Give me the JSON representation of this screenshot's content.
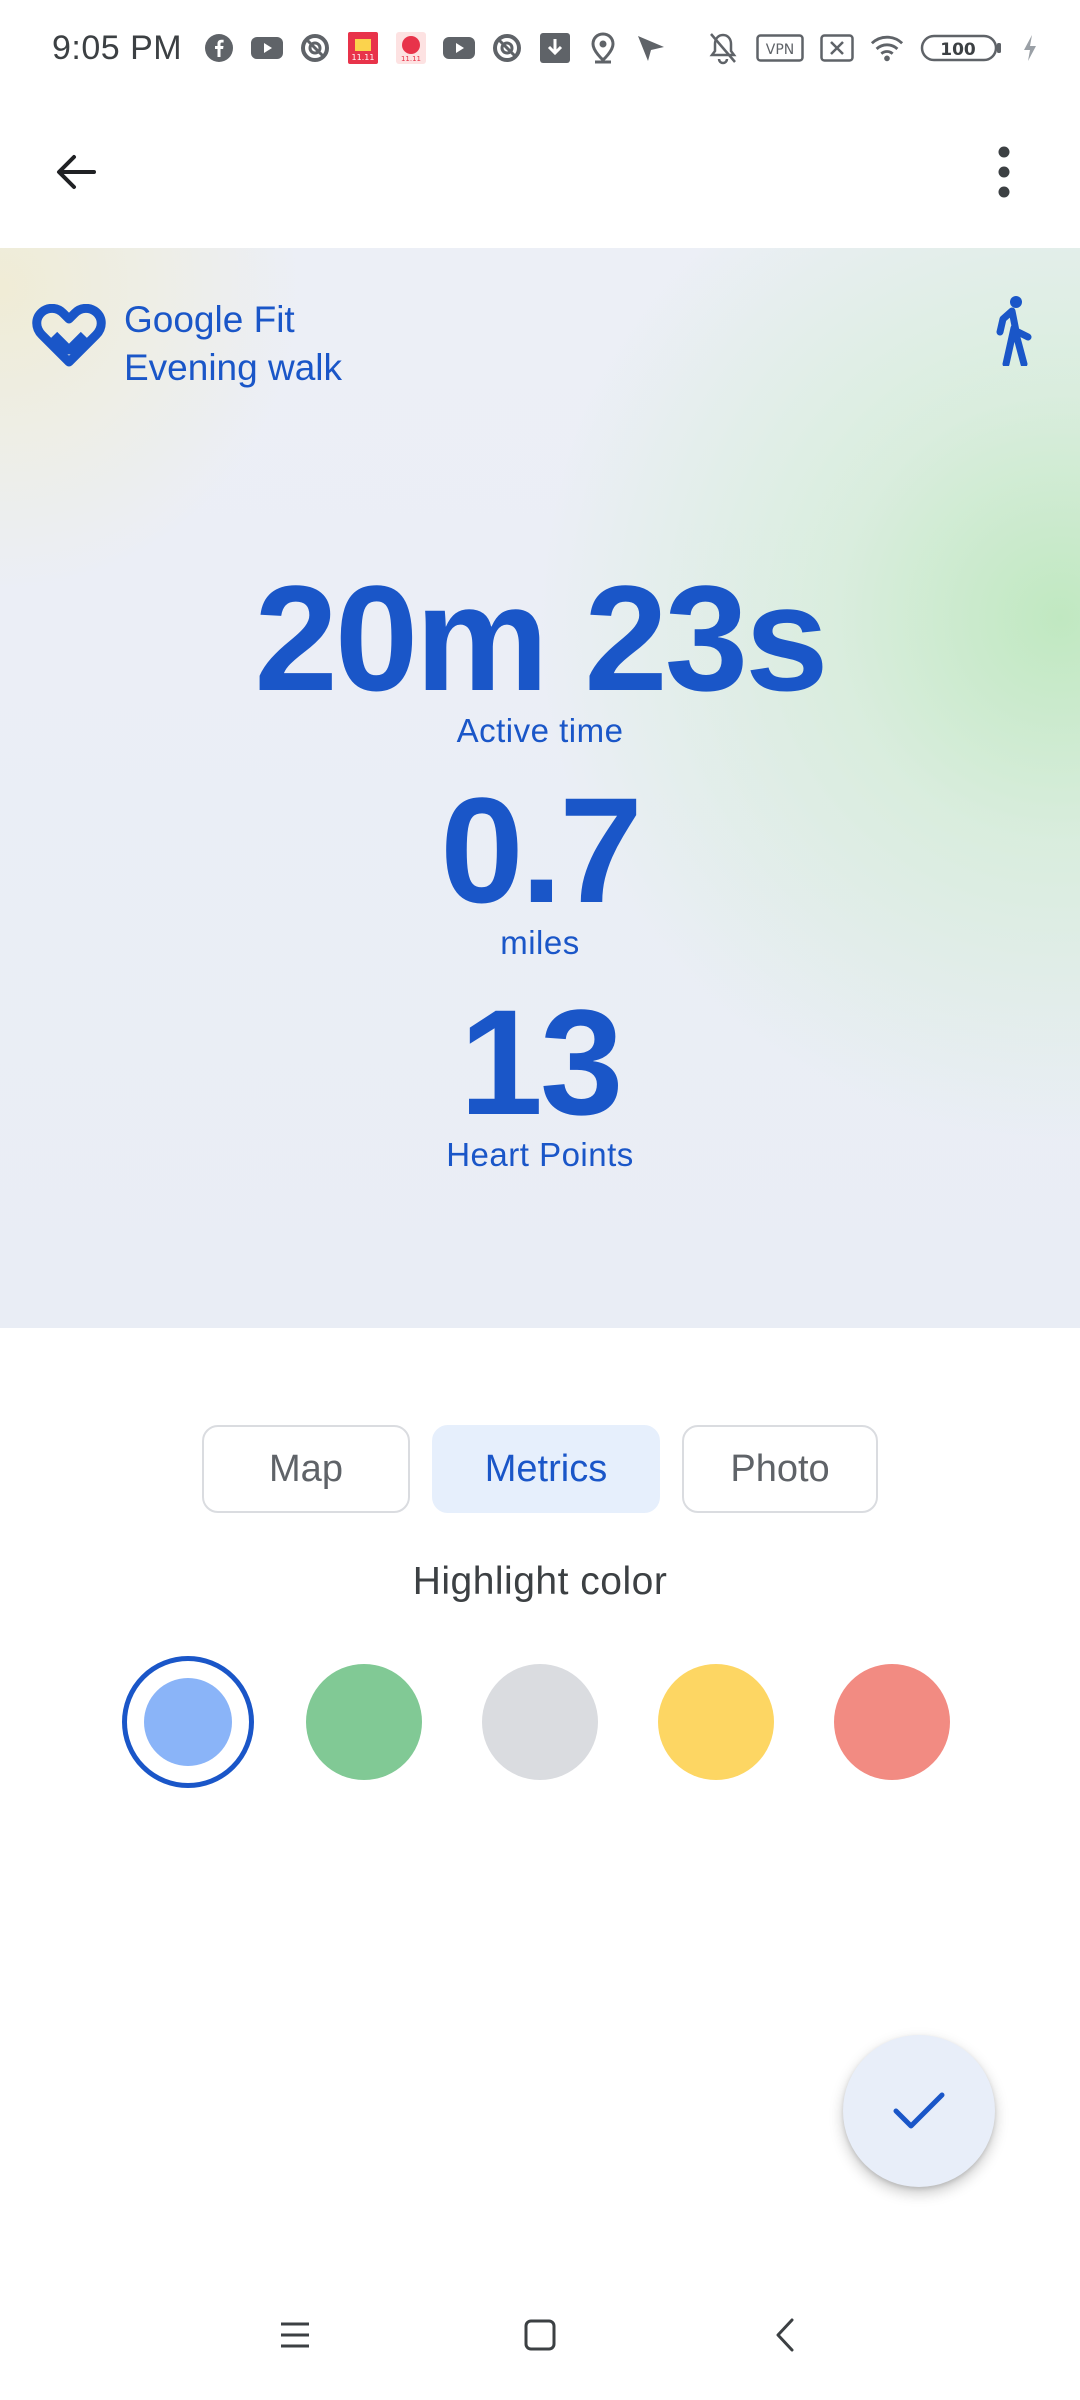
{
  "status_bar": {
    "time": "9:05 PM",
    "left_icons": [
      "facebook-icon",
      "youtube-icon",
      "blocked-icon",
      "app-icon-red",
      "app-icon-red-2",
      "youtube-icon",
      "blocked-icon",
      "download-icon",
      "location-icon",
      "send-icon"
    ],
    "right_icons": [
      "mute-bell-icon",
      "vpn-icon",
      "close-box-icon",
      "wifi-icon",
      "battery-icon",
      "charging-icon"
    ],
    "vpn_label": "VPN",
    "battery_label": "100"
  },
  "app_bar": {
    "back_icon": "arrow-back-icon",
    "menu_icon": "more-vert-icon"
  },
  "card": {
    "brand": "Google Fit",
    "activity_title": "Evening walk",
    "activity_icon": "walking-icon",
    "metrics": [
      {
        "value": "20m 23s",
        "label": "Active time"
      },
      {
        "value": "0.7",
        "label": "miles"
      },
      {
        "value": "13",
        "label": "Heart Points"
      }
    ],
    "brand_color": "#1a56c8"
  },
  "tabs": [
    {
      "label": "Map",
      "active": false
    },
    {
      "label": "Metrics",
      "active": true
    },
    {
      "label": "Photo",
      "active": false
    }
  ],
  "highlight": {
    "title": "Highlight color",
    "colors": [
      "#8ab4f8",
      "#81c995",
      "#dadce0",
      "#fdd663",
      "#f28b82"
    ],
    "selected_index": 0
  },
  "fab": {
    "icon": "check-icon"
  },
  "nav_bar": {
    "icons": [
      "menu-icon",
      "home-icon",
      "back-icon"
    ]
  }
}
